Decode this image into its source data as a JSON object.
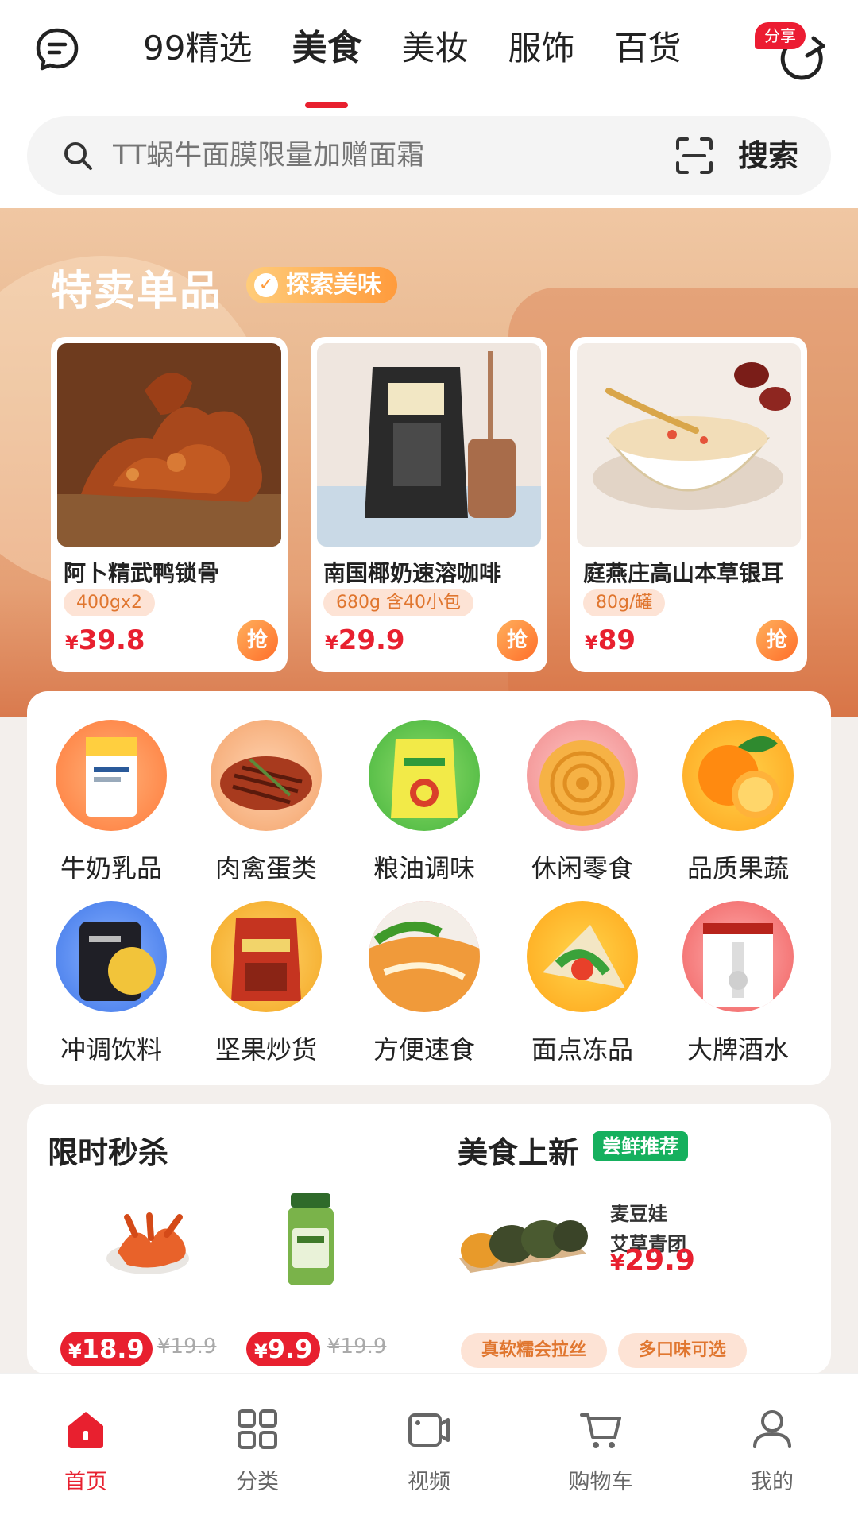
{
  "header": {
    "tabs": [
      {
        "label": "99精选",
        "active": false
      },
      {
        "label": "美食",
        "active": true
      },
      {
        "label": "美妆",
        "active": false
      },
      {
        "label": "服饰",
        "active": false
      },
      {
        "label": "百货",
        "active": false
      }
    ],
    "share_label": "分享"
  },
  "search": {
    "placeholder": "TT蜗牛面膜限量加赠面霜",
    "button_label": "搜索"
  },
  "special": {
    "title": "特卖单品",
    "tag": "探索美味",
    "buy_label": "抢",
    "currency": "¥",
    "items": [
      {
        "name": "阿卜精武鸭锁骨",
        "spec": "400gx2",
        "price": "39.8"
      },
      {
        "name": "南国椰奶速溶咖啡",
        "spec": "680g 含40小包",
        "price": "29.9"
      },
      {
        "name": "庭燕庄高山本草银耳",
        "spec": "80g/罐",
        "price": "89"
      }
    ]
  },
  "categories": [
    {
      "label": "牛奶乳品"
    },
    {
      "label": "肉禽蛋类"
    },
    {
      "label": "粮油调味"
    },
    {
      "label": "休闲零食"
    },
    {
      "label": "品质果蔬"
    },
    {
      "label": "冲调饮料"
    },
    {
      "label": "坚果炒货"
    },
    {
      "label": "方便速食"
    },
    {
      "label": "面点冻品"
    },
    {
      "label": "大牌酒水"
    }
  ],
  "flash_sale": {
    "title": "限时秒杀",
    "currency": "¥",
    "items": [
      {
        "price": "18.9",
        "original_price": "¥19.9"
      },
      {
        "price": "9.9",
        "original_price": "¥19.9"
      }
    ]
  },
  "new_food": {
    "title": "美食上新",
    "tag": "尝鲜推荐",
    "product": {
      "brand": "麦豆娃",
      "name": "艾草青团",
      "currency": "¥",
      "price": "29.9"
    },
    "features": [
      "真软糯会拉丝",
      "多口味可选"
    ]
  },
  "tabbar": {
    "items": [
      {
        "label": "首页",
        "icon": "home-icon",
        "active": true
      },
      {
        "label": "分类",
        "icon": "grid-icon",
        "active": false
      },
      {
        "label": "视频",
        "icon": "video-icon",
        "active": false
      },
      {
        "label": "购物车",
        "icon": "cart-icon",
        "active": false
      },
      {
        "label": "我的",
        "icon": "user-icon",
        "active": false
      }
    ]
  },
  "colors": {
    "accent": "#e8202f",
    "orange": "#ff8a2e",
    "fresh_green": "#16b05e"
  }
}
